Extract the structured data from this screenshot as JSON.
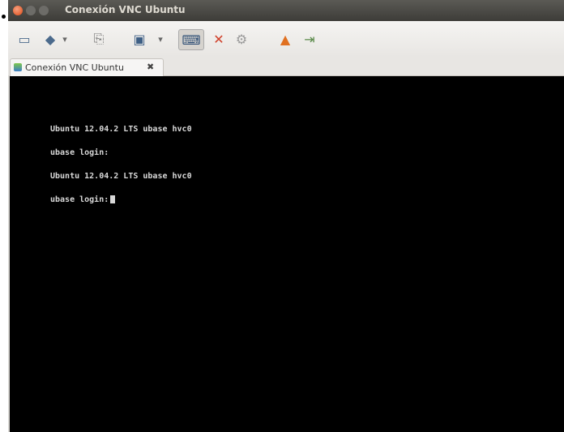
{
  "window": {
    "title": "Conexión VNC Ubuntu"
  },
  "toolbar": {
    "buttons": [
      {
        "name": "fullscreen-icon",
        "glyph": "▭"
      },
      {
        "name": "move-icon",
        "glyph": "◆"
      },
      {
        "name": "dropdown-icon",
        "glyph": "▾"
      },
      {
        "name": "clipboard-icon",
        "glyph": "⎘"
      },
      {
        "name": "screenshot-icon",
        "glyph": "▣"
      },
      {
        "name": "dropdown-icon",
        "glyph": "▾"
      },
      {
        "name": "keyboard-icon",
        "glyph": "⌨"
      },
      {
        "name": "tools-icon",
        "glyph": "✕"
      },
      {
        "name": "preferences-icon",
        "glyph": "⚙"
      },
      {
        "name": "minimize-icon",
        "glyph": "▲"
      },
      {
        "name": "disconnect-icon",
        "glyph": "⇥"
      }
    ]
  },
  "tab": {
    "label": "Conexión VNC Ubuntu",
    "close": "✖"
  },
  "terminal": {
    "lines": [
      "Ubuntu 12.04.2 LTS ubase hvc0",
      "ubase login:",
      "Ubuntu 12.04.2 LTS ubase hvc0",
      "ubase login:"
    ]
  }
}
